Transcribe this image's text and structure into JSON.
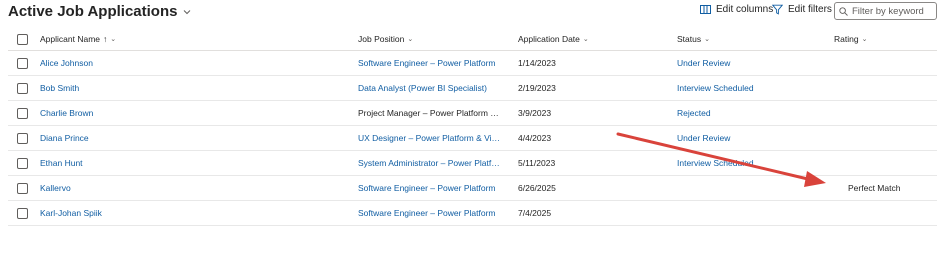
{
  "header": {
    "title": "Active Job Applications",
    "edit_columns": "Edit columns",
    "edit_filters": "Edit filters",
    "filter_placeholder": "Filter by keyword"
  },
  "columns": {
    "name": "Applicant Name",
    "name_sort": "↑",
    "position": "Job Position",
    "date": "Application Date",
    "status": "Status",
    "rating": "Rating"
  },
  "rows": [
    {
      "name": "Alice Johnson",
      "position": "Software Engineer – Power Platform",
      "date": "1/14/2023",
      "status": "Under Review",
      "rating": ""
    },
    {
      "name": "Bob Smith",
      "position": "Data Analyst (Power BI Specialist)",
      "date": "2/19/2023",
      "status": "Interview Scheduled",
      "rating": ""
    },
    {
      "name": "Charlie Brown",
      "position": "Project Manager – Power Platform Sol...",
      "date": "3/9/2023",
      "status": "Rejected",
      "rating": ""
    },
    {
      "name": "Diana Prince",
      "position": "UX Designer – Power Platform & Visua...",
      "date": "4/4/2023",
      "status": "Under Review",
      "rating": ""
    },
    {
      "name": "Ethan Hunt",
      "position": "System Administrator – Power Platfor...",
      "date": "5/11/2023",
      "status": "Interview Scheduled",
      "rating": ""
    },
    {
      "name": "Kallervo",
      "position": "Software Engineer – Power Platform",
      "date": "6/26/2025",
      "status": "",
      "rating": "Perfect Match"
    },
    {
      "name": "Karl-Johan Spiik",
      "position": "Software Engineer – Power Platform",
      "date": "7/4/2025",
      "status": "",
      "rating": ""
    }
  ],
  "annotation": {
    "arrow_color": "#d9433b"
  },
  "colors": {
    "link": "#115ea3",
    "text": "#242424",
    "border": "#e8e8e8"
  }
}
